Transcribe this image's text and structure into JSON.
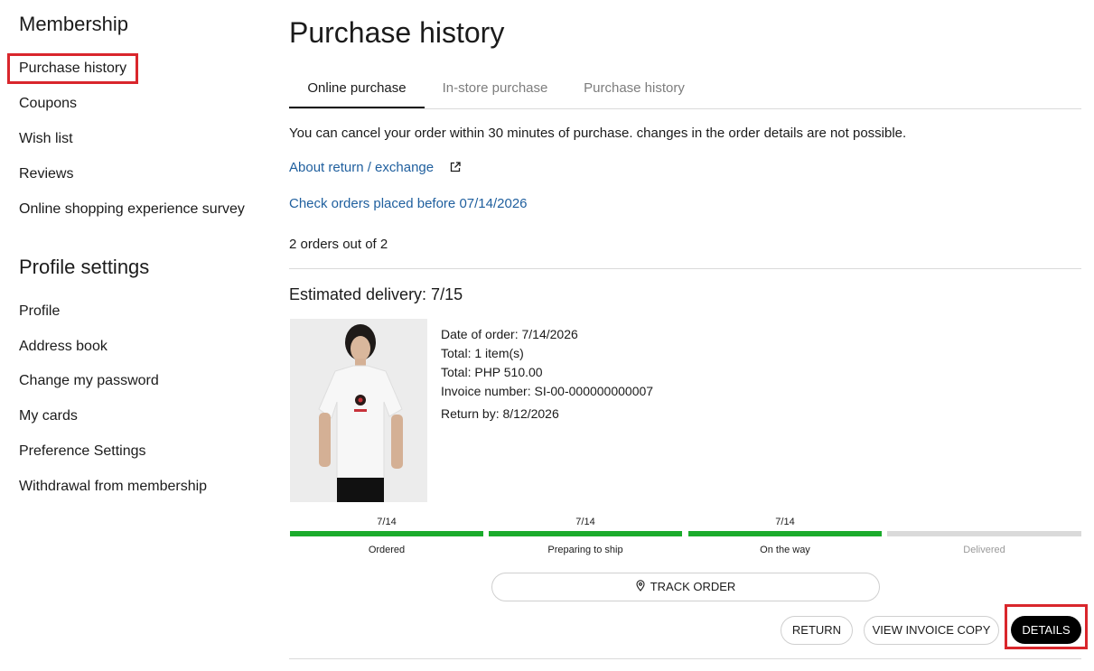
{
  "sidebar": {
    "membership_heading": "Membership",
    "membership_items": [
      {
        "label": "Purchase history"
      },
      {
        "label": "Coupons"
      },
      {
        "label": "Wish list"
      },
      {
        "label": "Reviews"
      },
      {
        "label": "Online shopping experience survey"
      }
    ],
    "profile_heading": "Profile settings",
    "profile_items": [
      {
        "label": "Profile"
      },
      {
        "label": "Address book"
      },
      {
        "label": "Change my password"
      },
      {
        "label": "My cards"
      },
      {
        "label": "Preference Settings"
      },
      {
        "label": "Withdrawal from membership"
      }
    ]
  },
  "main": {
    "title": "Purchase history",
    "tabs": [
      {
        "label": "Online purchase",
        "active": true
      },
      {
        "label": "In-store purchase",
        "active": false
      },
      {
        "label": "Purchase history",
        "active": false
      }
    ],
    "note": "You can cancel your order within 30 minutes of purchase. changes in the order details are not possible.",
    "return_link": "About return / exchange",
    "older_link": "Check orders placed before 07/14/2026",
    "count": "2 orders out of 2"
  },
  "order": {
    "estimated": "Estimated delivery: 7/15",
    "date_of_order": "Date of order: 7/14/2026",
    "total_items": "Total: 1 item(s)",
    "total_price": "Total: PHP 510.00",
    "invoice": "Invoice number: SI-00-000000000007",
    "return_by": "Return by: 8/12/2026",
    "steps": [
      {
        "date": "7/14",
        "label": "Ordered",
        "done": true
      },
      {
        "date": "7/14",
        "label": "Preparing to ship",
        "done": true
      },
      {
        "date": "7/14",
        "label": "On the way",
        "done": true
      },
      {
        "date": "",
        "label": "Delivered",
        "done": false
      }
    ],
    "track_label": "TRACK ORDER",
    "return_label": "RETURN",
    "invoice_label": "VIEW INVOICE COPY",
    "details_label": "DETAILS"
  },
  "colors": {
    "progress_done": "#1bab2c",
    "progress_pending": "#dadada",
    "link": "#1f5f9e",
    "highlight": "#d9262c"
  }
}
